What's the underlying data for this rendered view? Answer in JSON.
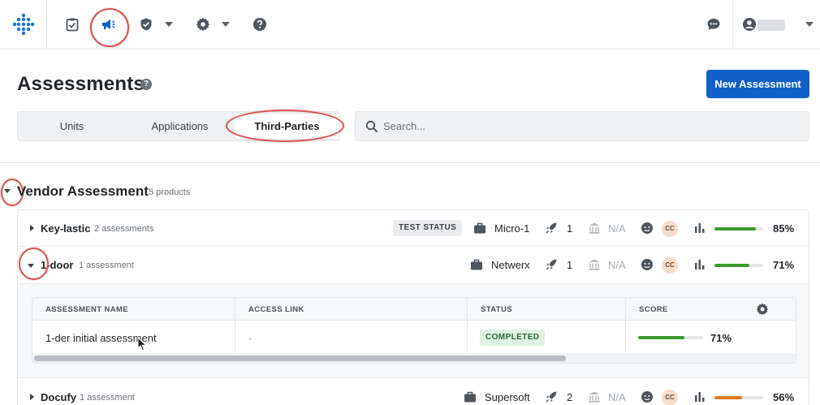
{
  "nav": {
    "icons": [
      "logo-icon",
      "checklist-icon",
      "megaphone-icon",
      "shield-check-icon",
      "gear-icon",
      "help-icon",
      "chat-icon",
      "user-icon"
    ]
  },
  "page": {
    "title": "Assessments",
    "help_glyph": "?",
    "new_button": "New Assessment"
  },
  "tabs": [
    {
      "label": "Units"
    },
    {
      "label": "Applications"
    },
    {
      "label": "Third-Parties"
    }
  ],
  "search": {
    "placeholder": "Search..."
  },
  "section": {
    "title": "Vendor Assessment",
    "subtitle": "5 products"
  },
  "rows": [
    {
      "name": "Key-lastic",
      "count": "2 assessments",
      "badge": "TEST STATUS",
      "product": "Micro-1",
      "deploys": "1",
      "na": "N/A",
      "avatar": "CC",
      "score": "85%",
      "score_fraction": 0.85,
      "bar_color": "#3c9a2f"
    },
    {
      "name": "1-door",
      "count": "1 assessment",
      "product": "Netwerx",
      "deploys": "1",
      "na": "N/A",
      "avatar": "CC",
      "score": "71%",
      "score_fraction": 0.71,
      "bar_color": "#3c9a2f"
    },
    {
      "name": "Docufy",
      "count": "1 assessment",
      "product": "Supersoft",
      "deploys": "2",
      "na": "N/A",
      "avatar": "CC",
      "score": "56%",
      "score_fraction": 0.56,
      "bar_color": "#e07b24"
    }
  ],
  "assessment_table": {
    "headers": [
      "ASSESSMENT NAME",
      "ACCESS LINK",
      "STATUS",
      "SCORE"
    ],
    "rows": [
      {
        "name": "1-der initial assessment",
        "link": "-",
        "status": "COMPLETED",
        "score": "71%",
        "score_fraction": 0.71
      }
    ]
  },
  "colors": {
    "accent": "#1160c7",
    "annotation": "#d9534f",
    "good": "#3c9a2f",
    "warn": "#e07b24"
  }
}
